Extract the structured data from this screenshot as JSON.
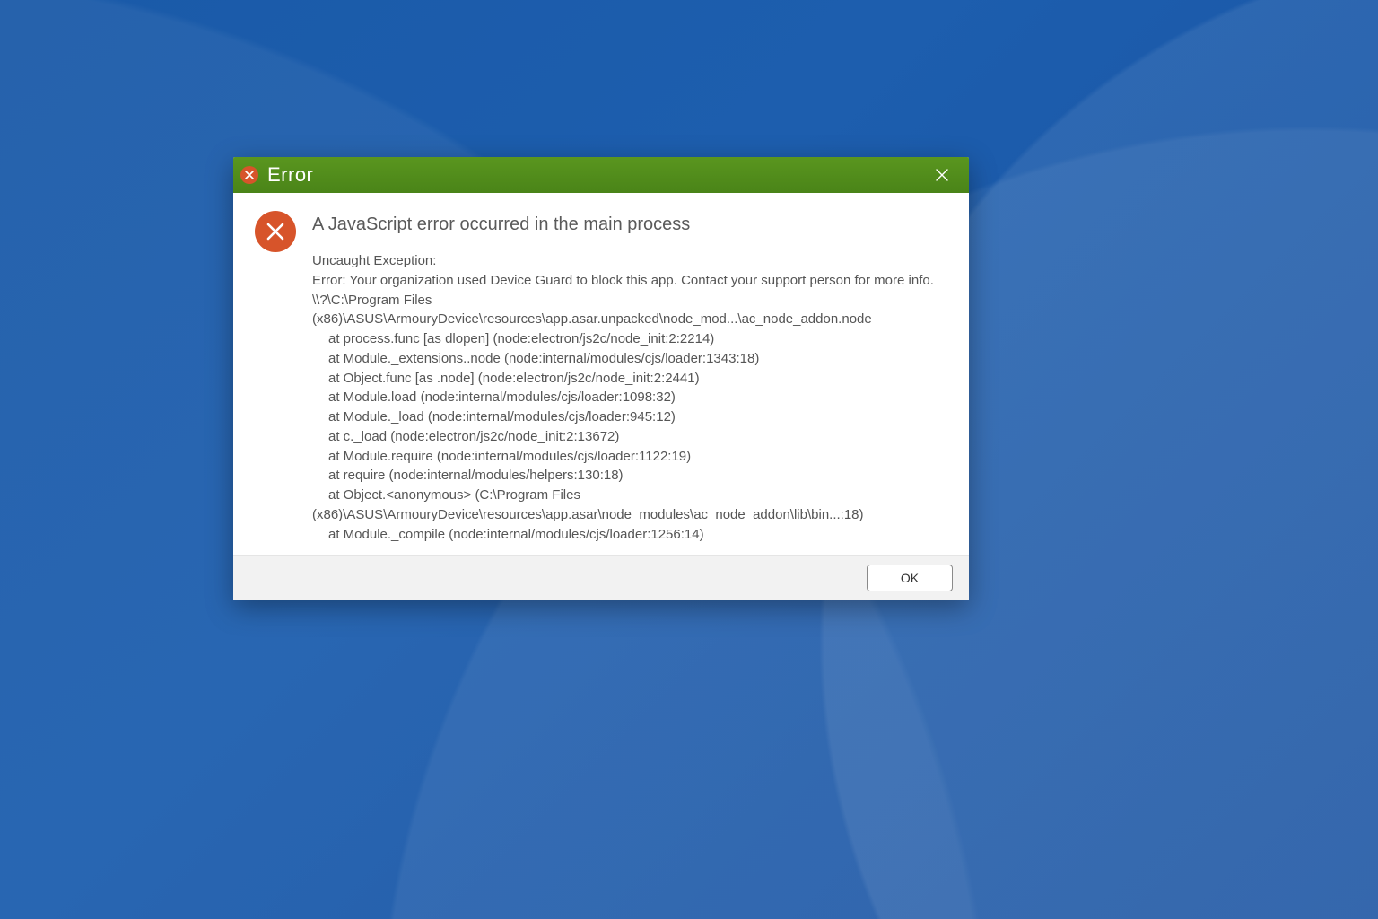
{
  "dialog": {
    "title": "Error",
    "heading": "A JavaScript error occurred in the main process",
    "exception_label": "Uncaught Exception:",
    "error_message": "Error: Your organization used Device Guard to block this app. Contact your support person for more info.",
    "path_line": "\\\\?\\C:\\Program Files (x86)\\ASUS\\ArmouryDevice\\resources\\app.asar.unpacked\\node_mod...\\ac_node_addon.node",
    "stack": [
      "at process.func [as dlopen] (node:electron/js2c/node_init:2:2214)",
      "at Module._extensions..node (node:internal/modules/cjs/loader:1343:18)",
      "at Object.func [as .node] (node:electron/js2c/node_init:2:2441)",
      "at Module.load (node:internal/modules/cjs/loader:1098:32)",
      "at Module._load (node:internal/modules/cjs/loader:945:12)",
      "at c._load (node:electron/js2c/node_init:2:13672)",
      "at Module.require (node:internal/modules/cjs/loader:1122:19)",
      "at require (node:internal/modules/helpers:130:18)"
    ],
    "stack_tail_noindent": "at Object.<anonymous> (C:\\Program Files (x86)\\ASUS\\ArmouryDevice\\resources\\app.asar\\node_modules\\ac_node_addon\\lib\\bin...:18)",
    "stack_last": "at Module._compile (node:internal/modules/cjs/loader:1256:14)",
    "ok_label": "OK"
  }
}
